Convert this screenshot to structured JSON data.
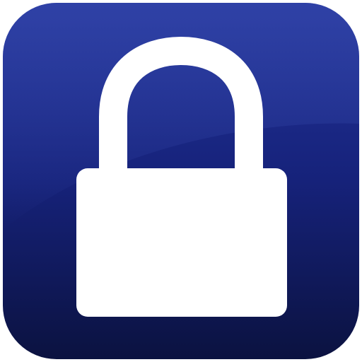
{
  "icon": {
    "name": "lock-icon",
    "colors": {
      "background_top": "#22339a",
      "background_mid": "#16227a",
      "background_bottom": "#0b1240",
      "gloss": "#3a4db0",
      "lock": "#ffffff"
    }
  }
}
